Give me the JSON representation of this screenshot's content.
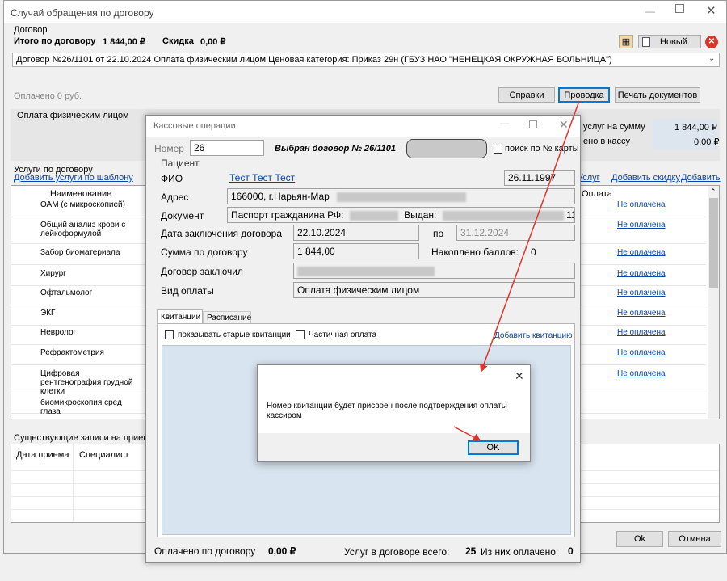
{
  "main": {
    "title": "Случай обращения по договору",
    "group_label": "Договор",
    "total_label": "Итого по договору",
    "total_value": "1 844,00 ₽",
    "discount_label": "Скидка",
    "discount_value": "0,00 ₽",
    "new_button": "Новый",
    "contract_select": "Договор №26/1101 от 22.10.2024 Оплата физическим лицом Ценовая категория: Приказ 29н (ГБУЗ НАО \"НЕНЕЦКАЯ ОКРУЖНАЯ БОЛЬНИЦА\")",
    "paid_text": "Оплачено 0 руб.",
    "btn_reference": "Справки",
    "btn_posting": "Проводка",
    "btn_print": "Печать документов",
    "payment_section": "Оплата физическим лицом",
    "services_sum_label": "услуг на сумму",
    "services_sum_value": "1 844,00 ₽",
    "to_cashbox_label": "ено в кассу",
    "to_cashbox_value": "0,00 ₽",
    "services_group": "Услуги по договору",
    "add_from_template": "Добавить услуги по шаблону",
    "link_services": "Услуг",
    "link_discount": "Добавить скидку",
    "link_add": "Добавить",
    "col_name": "Наименование",
    "col_payment": "Оплата",
    "services": [
      {
        "name": "ОАМ (с микроскопией)",
        "status": "Не оплачена"
      },
      {
        "name": "Общий анализ крови с лейкоформулой",
        "status": "Не оплачена"
      },
      {
        "name": "Забор биоматериала",
        "status": "Не оплачена"
      },
      {
        "name": "Хирург",
        "status": "Не оплачена"
      },
      {
        "name": "Офтальмолог",
        "status": "Не оплачена"
      },
      {
        "name": "ЭКГ",
        "status": "Не оплачена"
      },
      {
        "name": "Невролог",
        "status": "Не оплачена"
      },
      {
        "name": "Рефрактометрия",
        "status": "Не оплачена"
      },
      {
        "name": "Цифровая рентгенография грудной клетки",
        "status": "Не оплачена"
      },
      {
        "name": "биомикроскопия сред глаза",
        "status": ""
      }
    ],
    "existing_group": "Существующие записи на прием",
    "col_date": "Дата приема",
    "col_specialist": "Специалист",
    "btn_ok": "Ok",
    "btn_cancel": "Отмена"
  },
  "cash": {
    "title": "Кассовые операции",
    "number_label": "Номер",
    "number_value": "26",
    "selected_contract": "Выбран договор № 26/1101",
    "search_card_label": "поиск по № карты",
    "patient_group": "Пациент",
    "fio_label": "ФИО",
    "fio_value": "Тест Тест Тест",
    "birth_date": "26.11.1997",
    "address_label": "Адрес",
    "address_value": "166000, г.Нарьян-Мар",
    "document_label": "Документ",
    "document_value": "Паспорт гражданина РФ:",
    "issued_label": "Выдан:",
    "issued_tail": "11",
    "contract_date_label": "Дата заключения договора",
    "contract_date_value": "22.10.2024",
    "to_label": "по",
    "to_value": "31.12.2024",
    "sum_label": "Сумма по договору",
    "sum_value": "1 844,00",
    "points_label": "Накоплено баллов:",
    "points_value": "0",
    "signed_label": "Договор заключил",
    "pay_type_label": "Вид оплаты",
    "pay_type_value": "Оплата физическим лицом",
    "tab_receipts": "Квитанции",
    "tab_schedule": "Расписание",
    "show_old": "показывать старые квитанции",
    "partial": "Частичная оплата",
    "add_receipt": "Добавить квитанцию",
    "paid_by_contract_label": "Оплачено по договору",
    "paid_by_contract_value": "0,00 ₽",
    "services_total_label": "Услуг в договоре всего:",
    "services_total_value": "25",
    "services_paid_label": "Из них оплачено:",
    "services_paid_value": "0"
  },
  "msg": {
    "text": "Номер квитанции будет присвоен после подтверждения оплаты кассиром",
    "ok": "OK"
  },
  "colors": {
    "accent": "#0078d7",
    "link": "#0645ad",
    "arrow": "#e0342a",
    "receipts_area": "#d8e4f0"
  }
}
